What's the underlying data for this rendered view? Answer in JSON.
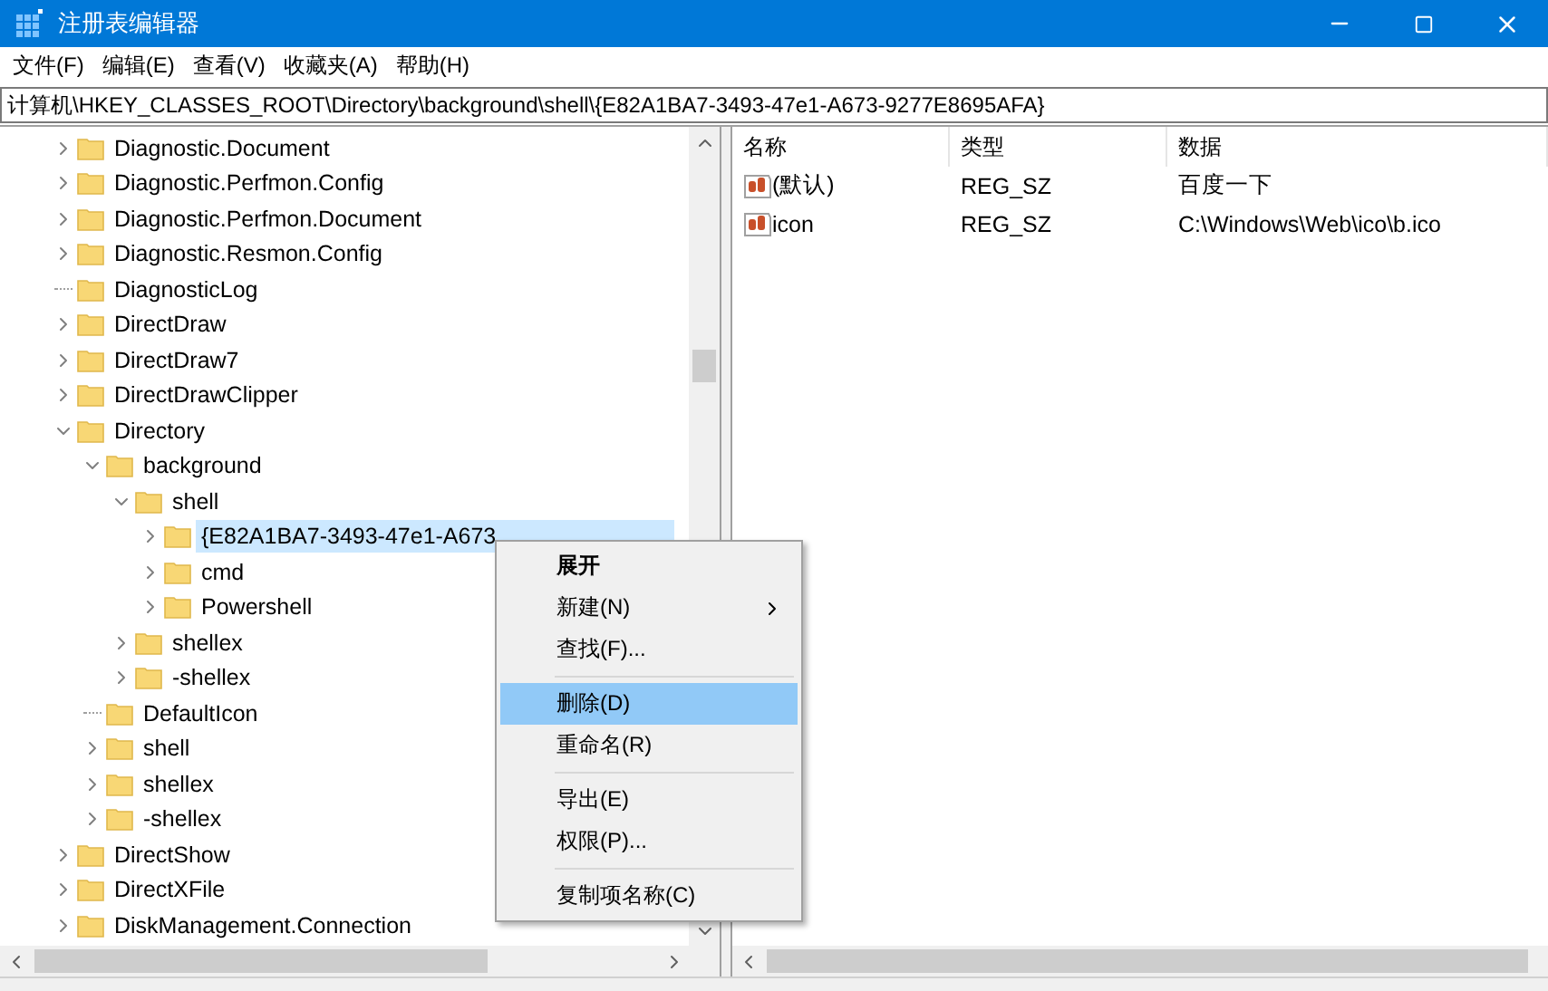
{
  "window": {
    "title": "注册表编辑器"
  },
  "menu": [
    "文件(F)",
    "编辑(E)",
    "查看(V)",
    "收藏夹(A)",
    "帮助(H)"
  ],
  "address": "计算机\\HKEY_CLASSES_ROOT\\Directory\\background\\shell\\{E82A1BA7-3493-47e1-A673-9277E8695AFA}",
  "tree": [
    {
      "label": "Diagnostic.Document",
      "kind": "branch",
      "expanded": false,
      "selected": false
    },
    {
      "label": "Diagnostic.Perfmon.Config",
      "kind": "branch",
      "expanded": false,
      "selected": false
    },
    {
      "label": "Diagnostic.Perfmon.Document",
      "kind": "branch",
      "expanded": false,
      "selected": false
    },
    {
      "label": "Diagnostic.Resmon.Config",
      "kind": "branch",
      "expanded": false,
      "selected": false
    },
    {
      "label": "DiagnosticLog",
      "kind": "leaf",
      "selected": false
    },
    {
      "label": "DirectDraw",
      "kind": "branch",
      "expanded": false,
      "selected": false
    },
    {
      "label": "DirectDraw7",
      "kind": "branch",
      "expanded": false,
      "selected": false
    },
    {
      "label": "DirectDrawClipper",
      "kind": "branch",
      "expanded": false,
      "selected": false
    },
    {
      "label": "Directory",
      "kind": "branch",
      "expanded": true,
      "selected": false,
      "children": [
        {
          "label": "background",
          "kind": "branch",
          "expanded": true,
          "selected": false,
          "children": [
            {
              "label": "shell",
              "kind": "branch",
              "expanded": true,
              "selected": false,
              "children": [
                {
                  "label": "{E82A1BA7-3493-47e1-A673",
                  "kind": "branch",
                  "expanded": false,
                  "selected": true
                },
                {
                  "label": "cmd",
                  "kind": "branch",
                  "expanded": false,
                  "selected": false
                },
                {
                  "label": "Powershell",
                  "kind": "branch",
                  "expanded": false,
                  "selected": false
                }
              ]
            },
            {
              "label": "shellex",
              "kind": "branch",
              "expanded": false,
              "selected": false
            },
            {
              "label": "-shellex",
              "kind": "branch",
              "expanded": false,
              "selected": false
            }
          ]
        },
        {
          "label": "DefaultIcon",
          "kind": "leaf",
          "selected": false
        },
        {
          "label": "shell",
          "kind": "branch",
          "expanded": false,
          "selected": false
        },
        {
          "label": "shellex",
          "kind": "branch",
          "expanded": false,
          "selected": false
        },
        {
          "label": "-shellex",
          "kind": "branch",
          "expanded": false,
          "selected": false
        }
      ]
    },
    {
      "label": "DirectShow",
      "kind": "branch",
      "expanded": false,
      "selected": false
    },
    {
      "label": "DirectXFile",
      "kind": "branch",
      "expanded": false,
      "selected": false
    },
    {
      "label": "DiskManagement.Connection",
      "kind": "branch",
      "expanded": false,
      "selected": false
    }
  ],
  "values": {
    "columns": [
      "名称",
      "类型",
      "数据"
    ],
    "rows": [
      {
        "name": "(默认)",
        "type": "REG_SZ",
        "data": "百度一下"
      },
      {
        "name": "icon",
        "type": "REG_SZ",
        "data": "C:\\Windows\\Web\\ico\\b.ico"
      }
    ]
  },
  "context_menu": [
    {
      "kind": "item",
      "label": "展开",
      "default": true,
      "submenu": false,
      "selected": false
    },
    {
      "kind": "item",
      "label": "新建(N)",
      "default": false,
      "submenu": true,
      "selected": false
    },
    {
      "kind": "item",
      "label": "查找(F)...",
      "default": false,
      "submenu": false,
      "selected": false
    },
    {
      "kind": "separator"
    },
    {
      "kind": "item",
      "label": "删除(D)",
      "default": false,
      "submenu": false,
      "selected": true
    },
    {
      "kind": "item",
      "label": "重命名(R)",
      "default": false,
      "submenu": false,
      "selected": false
    },
    {
      "kind": "separator"
    },
    {
      "kind": "item",
      "label": "导出(E)",
      "default": false,
      "submenu": false,
      "selected": false
    },
    {
      "kind": "item",
      "label": "权限(P)...",
      "default": false,
      "submenu": false,
      "selected": false
    },
    {
      "kind": "separator"
    },
    {
      "kind": "item",
      "label": "复制项名称(C)",
      "default": false,
      "submenu": false,
      "selected": false
    }
  ]
}
